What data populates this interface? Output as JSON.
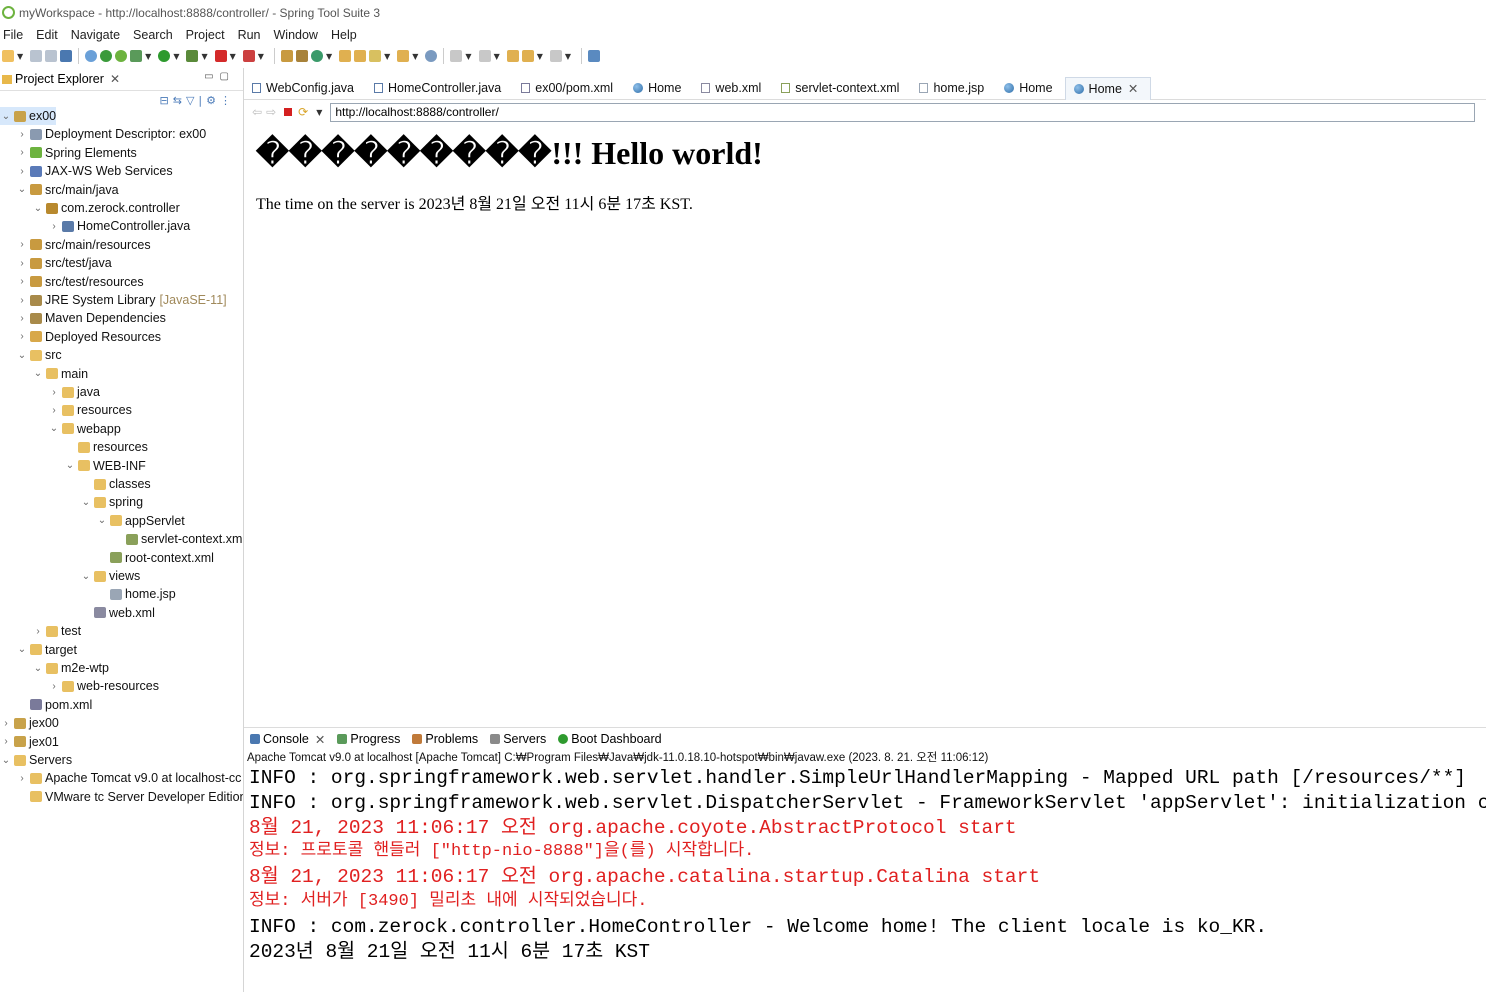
{
  "window": {
    "title": "myWorkspace - http://localhost:8888/controller/ - Spring Tool Suite 3"
  },
  "menu": [
    "File",
    "Edit",
    "Navigate",
    "Search",
    "Project",
    "Run",
    "Window",
    "Help"
  ],
  "project_explorer": {
    "title": "Project Explorer",
    "tree": [
      {
        "label": "ex00",
        "depth": 0,
        "twisty": "v",
        "icon": "project-icon",
        "selected": true
      },
      {
        "label": "Deployment Descriptor: ex00",
        "depth": 1,
        "twisty": ">",
        "icon": "deployment-descriptor-icon"
      },
      {
        "label": "Spring Elements",
        "depth": 1,
        "twisty": ">",
        "icon": "spring-leaf-icon"
      },
      {
        "label": "JAX-WS Web Services",
        "depth": 1,
        "twisty": ">",
        "icon": "web-services-icon"
      },
      {
        "label": "src/main/java",
        "depth": 1,
        "twisty": "v",
        "icon": "source-folder-icon"
      },
      {
        "label": "com.zerock.controller",
        "depth": 2,
        "twisty": "v",
        "icon": "package-icon"
      },
      {
        "label": "HomeController.java",
        "depth": 3,
        "twisty": ">",
        "icon": "java-file-icon"
      },
      {
        "label": "src/main/resources",
        "depth": 1,
        "twisty": ">",
        "icon": "source-folder-icon"
      },
      {
        "label": "src/test/java",
        "depth": 1,
        "twisty": ">",
        "icon": "source-folder-icon"
      },
      {
        "label": "src/test/resources",
        "depth": 1,
        "twisty": ">",
        "icon": "source-folder-icon"
      },
      {
        "label": "JRE System Library",
        "decoration": "[JavaSE-11]",
        "depth": 1,
        "twisty": ">",
        "icon": "library-icon"
      },
      {
        "label": "Maven Dependencies",
        "depth": 1,
        "twisty": ">",
        "icon": "library-icon"
      },
      {
        "label": "Deployed Resources",
        "depth": 1,
        "twisty": ">",
        "icon": "deployed-resources-icon"
      },
      {
        "label": "src",
        "depth": 1,
        "twisty": "v",
        "icon": "folder-icon"
      },
      {
        "label": "main",
        "depth": 2,
        "twisty": "v",
        "icon": "folder-icon"
      },
      {
        "label": "java",
        "depth": 3,
        "twisty": ">",
        "icon": "folder-icon"
      },
      {
        "label": "resources",
        "depth": 3,
        "twisty": ">",
        "icon": "folder-icon"
      },
      {
        "label": "webapp",
        "depth": 3,
        "twisty": "v",
        "icon": "folder-icon"
      },
      {
        "label": "resources",
        "depth": 4,
        "twisty": "",
        "icon": "folder-icon"
      },
      {
        "label": "WEB-INF",
        "depth": 4,
        "twisty": "v",
        "icon": "folder-icon"
      },
      {
        "label": "classes",
        "depth": 5,
        "twisty": "",
        "icon": "folder-icon"
      },
      {
        "label": "spring",
        "depth": 5,
        "twisty": "v",
        "icon": "folder-icon"
      },
      {
        "label": "appServlet",
        "depth": 6,
        "twisty": "v",
        "icon": "folder-icon"
      },
      {
        "label": "servlet-context.xml",
        "depth": 7,
        "twisty": "",
        "icon": "spring-xml-icon"
      },
      {
        "label": "root-context.xml",
        "depth": 6,
        "twisty": "",
        "icon": "spring-xml-icon"
      },
      {
        "label": "views",
        "depth": 5,
        "twisty": "v",
        "icon": "folder-icon"
      },
      {
        "label": "home.jsp",
        "depth": 6,
        "twisty": "",
        "icon": "jsp-file-icon"
      },
      {
        "label": "web.xml",
        "depth": 5,
        "twisty": "",
        "icon": "xml-file-icon"
      },
      {
        "label": "test",
        "depth": 2,
        "twisty": ">",
        "icon": "folder-icon"
      },
      {
        "label": "target",
        "depth": 1,
        "twisty": "v",
        "icon": "folder-icon"
      },
      {
        "label": "m2e-wtp",
        "depth": 2,
        "twisty": "v",
        "icon": "folder-icon"
      },
      {
        "label": "web-resources",
        "depth": 3,
        "twisty": ">",
        "icon": "folder-icon"
      },
      {
        "label": "pom.xml",
        "depth": 1,
        "twisty": "",
        "icon": "maven-file-icon"
      },
      {
        "label": "jex00",
        "depth": 0,
        "twisty": ">",
        "icon": "project-icon"
      },
      {
        "label": "jex01",
        "depth": 0,
        "twisty": ">",
        "icon": "project-icon"
      },
      {
        "label": "Servers",
        "depth": 0,
        "twisty": "v",
        "icon": "folder-icon"
      },
      {
        "label": "Apache Tomcat v9.0  at localhost-cc",
        "depth": 1,
        "twisty": ">",
        "icon": "folder-icon"
      },
      {
        "label": "VMware tc Server Developer Edition",
        "depth": 1,
        "twisty": "",
        "icon": "folder-icon"
      }
    ]
  },
  "editor_tabs": [
    {
      "label": "WebConfig.java",
      "icon": "java-file-icon",
      "active": false
    },
    {
      "label": "HomeController.java",
      "icon": "java-file-icon",
      "active": false
    },
    {
      "label": "ex00/pom.xml",
      "icon": "maven-file-icon",
      "active": false
    },
    {
      "label": "Home",
      "icon": "globe-icon",
      "active": false
    },
    {
      "label": "web.xml",
      "icon": "xml-file-icon",
      "active": false
    },
    {
      "label": "servlet-context.xml",
      "icon": "spring-xml-icon",
      "active": false
    },
    {
      "label": "home.jsp",
      "icon": "jsp-file-icon",
      "active": false
    },
    {
      "label": "Home",
      "icon": "globe-icon",
      "active": false
    },
    {
      "label": "Home",
      "icon": "globe-icon",
      "active": true
    }
  ],
  "browser": {
    "url": "http://localhost:8888/controller/",
    "heading": "���������!!! Hello world!",
    "time_text": "The time on the server is 2023년 8월 21일 오전 11시 6분 17초 KST."
  },
  "console": {
    "tabs": [
      {
        "label": "Console",
        "icon": "console-icon",
        "closable": true
      },
      {
        "label": "Progress",
        "icon": "progress-icon"
      },
      {
        "label": "Problems",
        "icon": "problems-icon"
      },
      {
        "label": "Servers",
        "icon": "servers-icon"
      },
      {
        "label": "Boot Dashboard",
        "icon": "boot-dashboard-icon"
      }
    ],
    "description": "Apache Tomcat v9.0  at localhost [Apache Tomcat] C:₩Program Files₩Java₩jdk-11.0.18.10-hotspot₩bin₩javaw.exe  (2023. 8. 21. 오전 11:06:12)",
    "lines": [
      {
        "text": "INFO : org.springframework.web.servlet.handler.SimpleUrlHandlerMapping - Mapped URL path [/resources/**]",
        "kind": "info"
      },
      {
        "text": "INFO : org.springframework.web.servlet.DispatcherServlet - FrameworkServlet 'appServlet': initialization completed",
        "kind": "info"
      },
      {
        "text": "8월 21, 2023 11:06:17 오전 org.apache.coyote.AbstractProtocol start",
        "kind": "err"
      },
      {
        "text": "정보: 프로토콜 핸들러 [\"http-nio-8888\"]을(를) 시작합니다.",
        "kind": "err-sm"
      },
      {
        "text": "8월 21, 2023 11:06:17 오전 org.apache.catalina.startup.Catalina start",
        "kind": "err"
      },
      {
        "text": "정보: 서버가 [3490] 밀리초 내에 시작되었습니다.",
        "kind": "err-sm"
      },
      {
        "text": "INFO : com.zerock.controller.HomeController - Welcome home! The client locale is ko_KR.",
        "kind": "info"
      },
      {
        "text": "2023년 8월 21일 오전 11시 6분 17초 KST",
        "kind": "info"
      }
    ]
  },
  "colors": {
    "selection": "#d7e8fb",
    "stderr": "#e02020",
    "spring_green": "#6db33f",
    "folder": "#e8b84a"
  }
}
